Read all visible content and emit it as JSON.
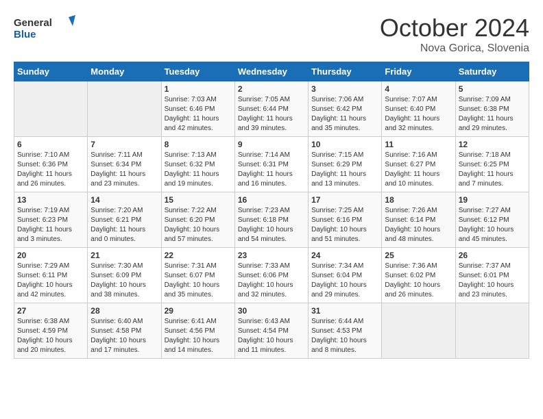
{
  "logo": {
    "line1": "General",
    "line2": "Blue"
  },
  "title": "October 2024",
  "subtitle": "Nova Gorica, Slovenia",
  "days_of_week": [
    "Sunday",
    "Monday",
    "Tuesday",
    "Wednesday",
    "Thursday",
    "Friday",
    "Saturday"
  ],
  "weeks": [
    [
      {
        "day": "",
        "info": ""
      },
      {
        "day": "",
        "info": ""
      },
      {
        "day": "1",
        "info": "Sunrise: 7:03 AM\nSunset: 6:46 PM\nDaylight: 11 hours and 42 minutes."
      },
      {
        "day": "2",
        "info": "Sunrise: 7:05 AM\nSunset: 6:44 PM\nDaylight: 11 hours and 39 minutes."
      },
      {
        "day": "3",
        "info": "Sunrise: 7:06 AM\nSunset: 6:42 PM\nDaylight: 11 hours and 35 minutes."
      },
      {
        "day": "4",
        "info": "Sunrise: 7:07 AM\nSunset: 6:40 PM\nDaylight: 11 hours and 32 minutes."
      },
      {
        "day": "5",
        "info": "Sunrise: 7:09 AM\nSunset: 6:38 PM\nDaylight: 11 hours and 29 minutes."
      }
    ],
    [
      {
        "day": "6",
        "info": "Sunrise: 7:10 AM\nSunset: 6:36 PM\nDaylight: 11 hours and 26 minutes."
      },
      {
        "day": "7",
        "info": "Sunrise: 7:11 AM\nSunset: 6:34 PM\nDaylight: 11 hours and 23 minutes."
      },
      {
        "day": "8",
        "info": "Sunrise: 7:13 AM\nSunset: 6:32 PM\nDaylight: 11 hours and 19 minutes."
      },
      {
        "day": "9",
        "info": "Sunrise: 7:14 AM\nSunset: 6:31 PM\nDaylight: 11 hours and 16 minutes."
      },
      {
        "day": "10",
        "info": "Sunrise: 7:15 AM\nSunset: 6:29 PM\nDaylight: 11 hours and 13 minutes."
      },
      {
        "day": "11",
        "info": "Sunrise: 7:16 AM\nSunset: 6:27 PM\nDaylight: 11 hours and 10 minutes."
      },
      {
        "day": "12",
        "info": "Sunrise: 7:18 AM\nSunset: 6:25 PM\nDaylight: 11 hours and 7 minutes."
      }
    ],
    [
      {
        "day": "13",
        "info": "Sunrise: 7:19 AM\nSunset: 6:23 PM\nDaylight: 11 hours and 3 minutes."
      },
      {
        "day": "14",
        "info": "Sunrise: 7:20 AM\nSunset: 6:21 PM\nDaylight: 11 hours and 0 minutes."
      },
      {
        "day": "15",
        "info": "Sunrise: 7:22 AM\nSunset: 6:20 PM\nDaylight: 10 hours and 57 minutes."
      },
      {
        "day": "16",
        "info": "Sunrise: 7:23 AM\nSunset: 6:18 PM\nDaylight: 10 hours and 54 minutes."
      },
      {
        "day": "17",
        "info": "Sunrise: 7:25 AM\nSunset: 6:16 PM\nDaylight: 10 hours and 51 minutes."
      },
      {
        "day": "18",
        "info": "Sunrise: 7:26 AM\nSunset: 6:14 PM\nDaylight: 10 hours and 48 minutes."
      },
      {
        "day": "19",
        "info": "Sunrise: 7:27 AM\nSunset: 6:12 PM\nDaylight: 10 hours and 45 minutes."
      }
    ],
    [
      {
        "day": "20",
        "info": "Sunrise: 7:29 AM\nSunset: 6:11 PM\nDaylight: 10 hours and 42 minutes."
      },
      {
        "day": "21",
        "info": "Sunrise: 7:30 AM\nSunset: 6:09 PM\nDaylight: 10 hours and 38 minutes."
      },
      {
        "day": "22",
        "info": "Sunrise: 7:31 AM\nSunset: 6:07 PM\nDaylight: 10 hours and 35 minutes."
      },
      {
        "day": "23",
        "info": "Sunrise: 7:33 AM\nSunset: 6:06 PM\nDaylight: 10 hours and 32 minutes."
      },
      {
        "day": "24",
        "info": "Sunrise: 7:34 AM\nSunset: 6:04 PM\nDaylight: 10 hours and 29 minutes."
      },
      {
        "day": "25",
        "info": "Sunrise: 7:36 AM\nSunset: 6:02 PM\nDaylight: 10 hours and 26 minutes."
      },
      {
        "day": "26",
        "info": "Sunrise: 7:37 AM\nSunset: 6:01 PM\nDaylight: 10 hours and 23 minutes."
      }
    ],
    [
      {
        "day": "27",
        "info": "Sunrise: 6:38 AM\nSunset: 4:59 PM\nDaylight: 10 hours and 20 minutes."
      },
      {
        "day": "28",
        "info": "Sunrise: 6:40 AM\nSunset: 4:58 PM\nDaylight: 10 hours and 17 minutes."
      },
      {
        "day": "29",
        "info": "Sunrise: 6:41 AM\nSunset: 4:56 PM\nDaylight: 10 hours and 14 minutes."
      },
      {
        "day": "30",
        "info": "Sunrise: 6:43 AM\nSunset: 4:54 PM\nDaylight: 10 hours and 11 minutes."
      },
      {
        "day": "31",
        "info": "Sunrise: 6:44 AM\nSunset: 4:53 PM\nDaylight: 10 hours and 8 minutes."
      },
      {
        "day": "",
        "info": ""
      },
      {
        "day": "",
        "info": ""
      }
    ]
  ]
}
